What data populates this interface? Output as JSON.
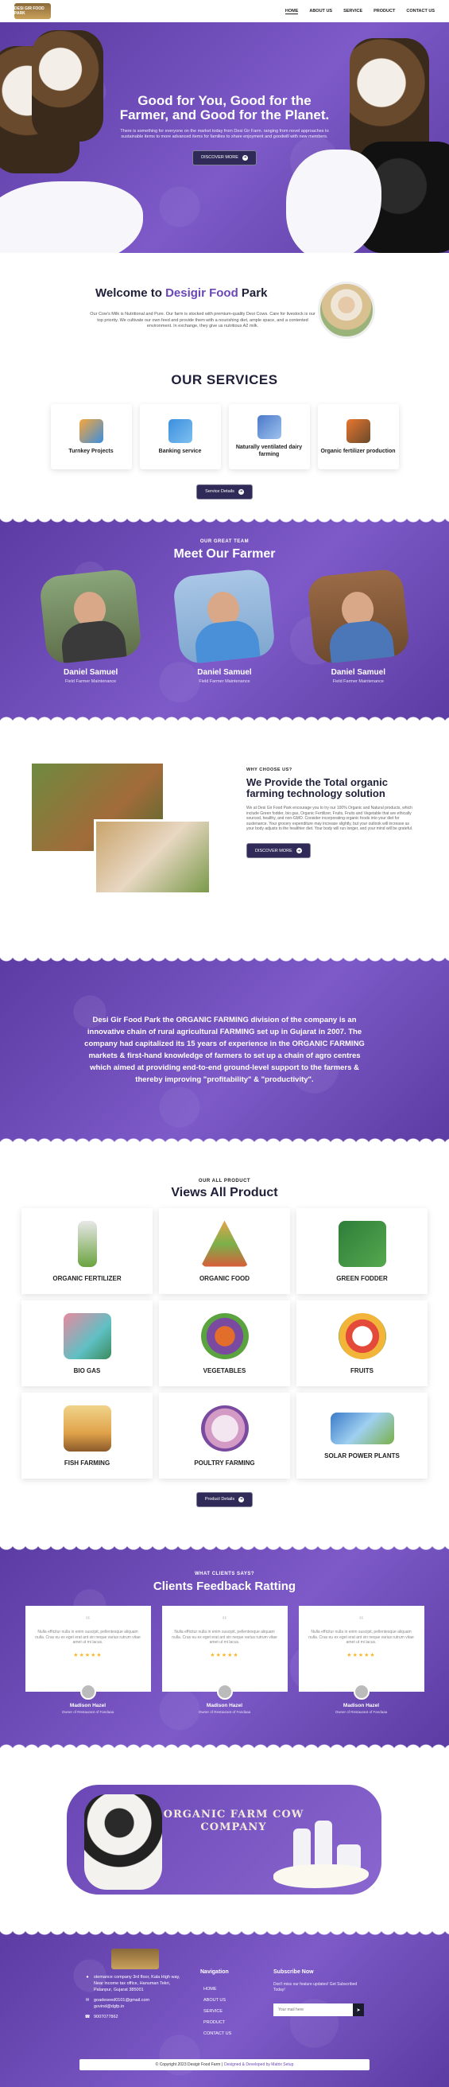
{
  "header": {
    "logo_text": "DESI GIR FOOD PARK",
    "nav": [
      "HOME",
      "ABOUT US",
      "SERVICE",
      "PRODUCT",
      "CONTACT US"
    ]
  },
  "hero": {
    "title": "Good for You, Good for the Farmer, and Good for the Planet.",
    "subtitle": "There is something for everyone on the market today from Desi Gir Farm. ranging from novel approaches to sustainable items to more advanced items for families to share enjoyment and goodwill with new members.",
    "button": "DISCOVER MORE"
  },
  "welcome": {
    "title_prefix": "Welcome to ",
    "title_accent": "Desigir Food",
    "title_suffix": " Park",
    "text": "Our Cow's Milk is Nutritional and Pure. Our farm is stocked with premium-quality Desi Cows. Care for livestock is our top priority. We cultivate our own feed and provide them with a nourishing diet, ample space, and a contented environment. In exchange, they give us nutritious A2 milk."
  },
  "services": {
    "title": "OUR SERVICES",
    "items": [
      "Turnkey Projects",
      "Banking service",
      "Naturally ventilated dairy farming",
      "Organic fertilizer production"
    ],
    "button": "Service Details"
  },
  "farmers": {
    "eyebrow": "OUR GREAT TEAM",
    "title": "Meet Our Farmer",
    "items": [
      {
        "name": "Daniel Samuel",
        "role": "Field Farmer Maintenance"
      },
      {
        "name": "Daniel Samuel",
        "role": "Field Farmer Maintenance"
      },
      {
        "name": "Daniel Samuel",
        "role": "Field Farmer Maintenance"
      }
    ]
  },
  "why": {
    "eyebrow": "WHY CHOOSE US?",
    "title": "We Provide the Total organic farming technology solution",
    "text": "We at Desi Gir Food Park encourage you to try our 100% Organic and Natural products, which include Green fodder, bio gas, Organic Fertilizer, Fruits, Fruits and Vegetable that are ethically sourced, healthy, and non-GMO. Consider incorporating organic foods into your diet for sustenance. Your grocery expenditure may increase slightly, but your outlook will increase as your body adjusts to the healthier diet. Your body will run longer, and your mind will be grateful.",
    "button": "DISCOVER MORE"
  },
  "banner": {
    "text": "Desi Gir Food Park the ORGANIC FARMING division of the company is an innovative chain of rural agricultural FARMING set up in Gujarat in 2007. The company had capitalized its 15 years of experience in the ORGANIC FARMING markets & first-hand knowledge of farmers to set up a chain of agro centres which aimed at providing end-to-end ground-level support to the farmers & thereby improving \"profitability\" & \"productivity\"."
  },
  "products": {
    "eyebrow": "OUR ALL PRODUCT",
    "title": "Views All Product",
    "items": [
      "ORGANIC FERTILIZER",
      "ORGANIC FOOD",
      "GREEN FODDER",
      "BIO GAS",
      "VEGETABLES",
      "FRUITS",
      "FISH FARMING",
      "POULTRY FARMING",
      "SOLAR POWER PLANTS"
    ],
    "button": "Product Details"
  },
  "feedback": {
    "eyebrow": "WHAT CLIENTS SAYS?",
    "title": "Clients Feedback Ratting",
    "items": [
      {
        "text": "Nulla efficitur nulla in enim suscipit, pellentesque aliquam nulla. Cras eu ex eget erat ant sin neque varius rutrum vitae amet ut mi lacus.",
        "name": "Madison Hazel",
        "role": "Owner of Restaurant of Fandaaa"
      },
      {
        "text": "Nulla efficitur nulla in enim suscipit, pellentesque aliquam nulla. Cras eu ex eget erat ant sin neque varius rutrum vitae amet ut mi lacus.",
        "name": "Madison Hazel",
        "role": "Owner of Restaurant of Fandaaa"
      },
      {
        "text": "Nulla efficitur nulla in enim suscipit, pellentesque aliquam nulla. Cras eu ex eget erat ant sin neque varius rutrum vitae amet ut mi lacus.",
        "name": "Madison Hazel",
        "role": "Owner of Restaurant of Fandaaa"
      }
    ],
    "stars": "★★★★★"
  },
  "promo": {
    "title": "ORGANIC FARM COW COMPANY"
  },
  "footer": {
    "address": "stemance company 3rd floor, Kala High way, Near income tax office, Hanuman Tekri, Palanpur, Gujarat 385001",
    "email1": "goadeseed0101@gmail.com",
    "email2": "govind@dgfp.in",
    "phone": "9007077862",
    "nav_title": "Navigation",
    "nav_links": [
      "HOME",
      "ABOUT US",
      "SERVICE",
      "PRODUCT",
      "CONTACT US"
    ],
    "subscribe_title": "Subscribe Now",
    "subscribe_text": "Don't miss our feature updates! Get Subscribed Today!",
    "subscribe_placeholder": "Your mail here",
    "copyright": "© Copyright 2023 Desigir Food Farm |",
    "credit": "Designed & Developed by Matrix Setup"
  },
  "colors": {
    "primary": "#6a47b5",
    "dark": "#2f2a57",
    "star": "#f5b82e"
  }
}
